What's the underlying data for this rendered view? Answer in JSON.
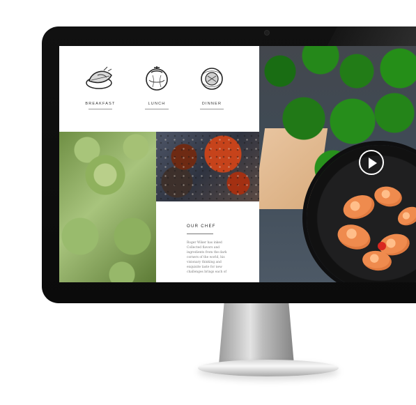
{
  "menu": {
    "items": [
      {
        "label": "BREAKFAST",
        "icon": "breakfast-icon"
      },
      {
        "label": "LUNCH",
        "icon": "lunch-icon"
      },
      {
        "label": "DINNER",
        "icon": "dinner-icon"
      }
    ]
  },
  "chef": {
    "title": "OUR CHEF",
    "text": "Roger Wiker has inked Collected flavors and ingredients from the dark corners of the world, his visionary thinking and exquisite taste for new challenges brings each of"
  },
  "hero": {
    "play_label": "play-icon"
  }
}
